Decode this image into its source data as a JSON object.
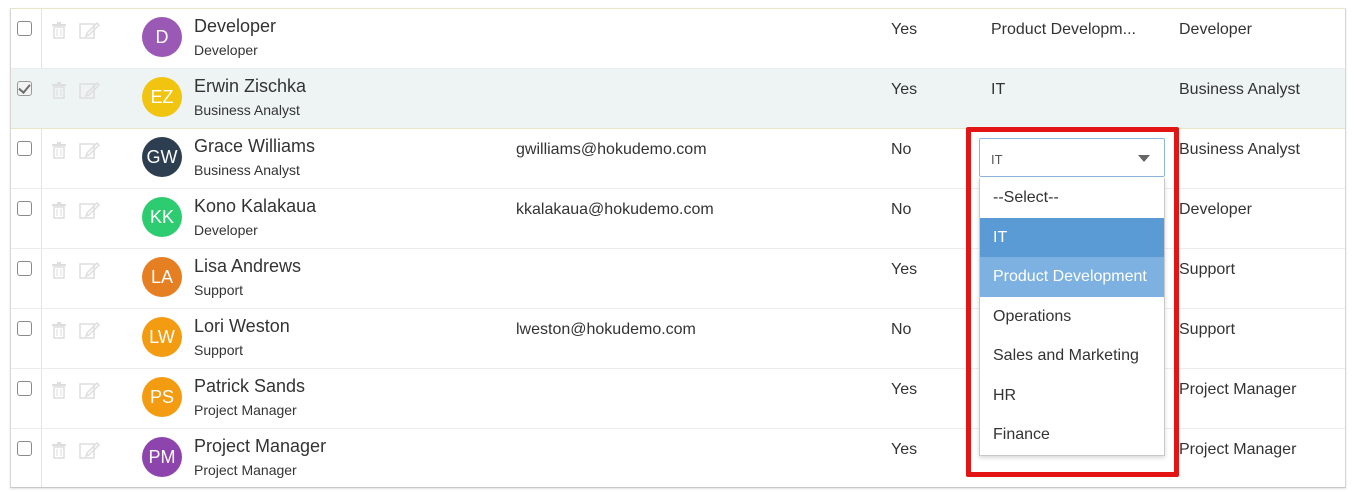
{
  "rows": [
    {
      "initials": "D",
      "avatar_color": "#9b59b6",
      "name": "Developer",
      "title": "Developer",
      "email": "",
      "active": "Yes",
      "department": "Product Developm...",
      "role": "Developer",
      "checked": false
    },
    {
      "initials": "EZ",
      "avatar_color": "#f1c40f",
      "name": "Erwin Zischka",
      "title": "Business Analyst",
      "email": "",
      "active": "Yes",
      "department": "IT",
      "role": "Business Analyst",
      "checked": true
    },
    {
      "initials": "GW",
      "avatar_color": "#2c3e50",
      "name": "Grace Williams",
      "title": "Business Analyst",
      "email": "gwilliams@hokudemo.com",
      "active": "No",
      "department": "",
      "role": "Business Analyst",
      "checked": false
    },
    {
      "initials": "KK",
      "avatar_color": "#2ecc71",
      "name": "Kono Kalakaua",
      "title": "Developer",
      "email": "kkalakaua@hokudemo.com",
      "active": "No",
      "department": "",
      "role": "Developer",
      "checked": false
    },
    {
      "initials": "LA",
      "avatar_color": "#e67e22",
      "name": "Lisa Andrews",
      "title": "Support",
      "email": "",
      "active": "Yes",
      "department": "",
      "role": "Support",
      "checked": false
    },
    {
      "initials": "LW",
      "avatar_color": "#f39c12",
      "name": "Lori Weston",
      "title": "Support",
      "email": "lweston@hokudemo.com",
      "active": "No",
      "department": "",
      "role": "Support",
      "checked": false
    },
    {
      "initials": "PS",
      "avatar_color": "#f39c12",
      "name": "Patrick Sands",
      "title": "Project Manager",
      "email": "",
      "active": "Yes",
      "department": "",
      "role": "Project Manager",
      "checked": false
    },
    {
      "initials": "PM",
      "avatar_color": "#8e44ad",
      "name": "Project Manager",
      "title": "Project Manager",
      "email": "",
      "active": "Yes",
      "department": "",
      "role": "Project Manager",
      "checked": false
    }
  ],
  "department_select": {
    "selected_value": "IT",
    "options": [
      "--Select--",
      "IT",
      "Product Development",
      "Operations",
      "Sales and Marketing",
      "HR",
      "Finance"
    ],
    "active_option": "IT",
    "hovered_option": "Product Development"
  },
  "icons": {
    "delete": "trash-icon",
    "edit": "pencil-edit-icon",
    "dropdown": "caret-down-icon"
  },
  "colors": {
    "selected_row": "#eef4f4",
    "option_active": "#5b9bd5",
    "option_hover": "#7cb1e2",
    "highlight_border": "#e21414"
  }
}
